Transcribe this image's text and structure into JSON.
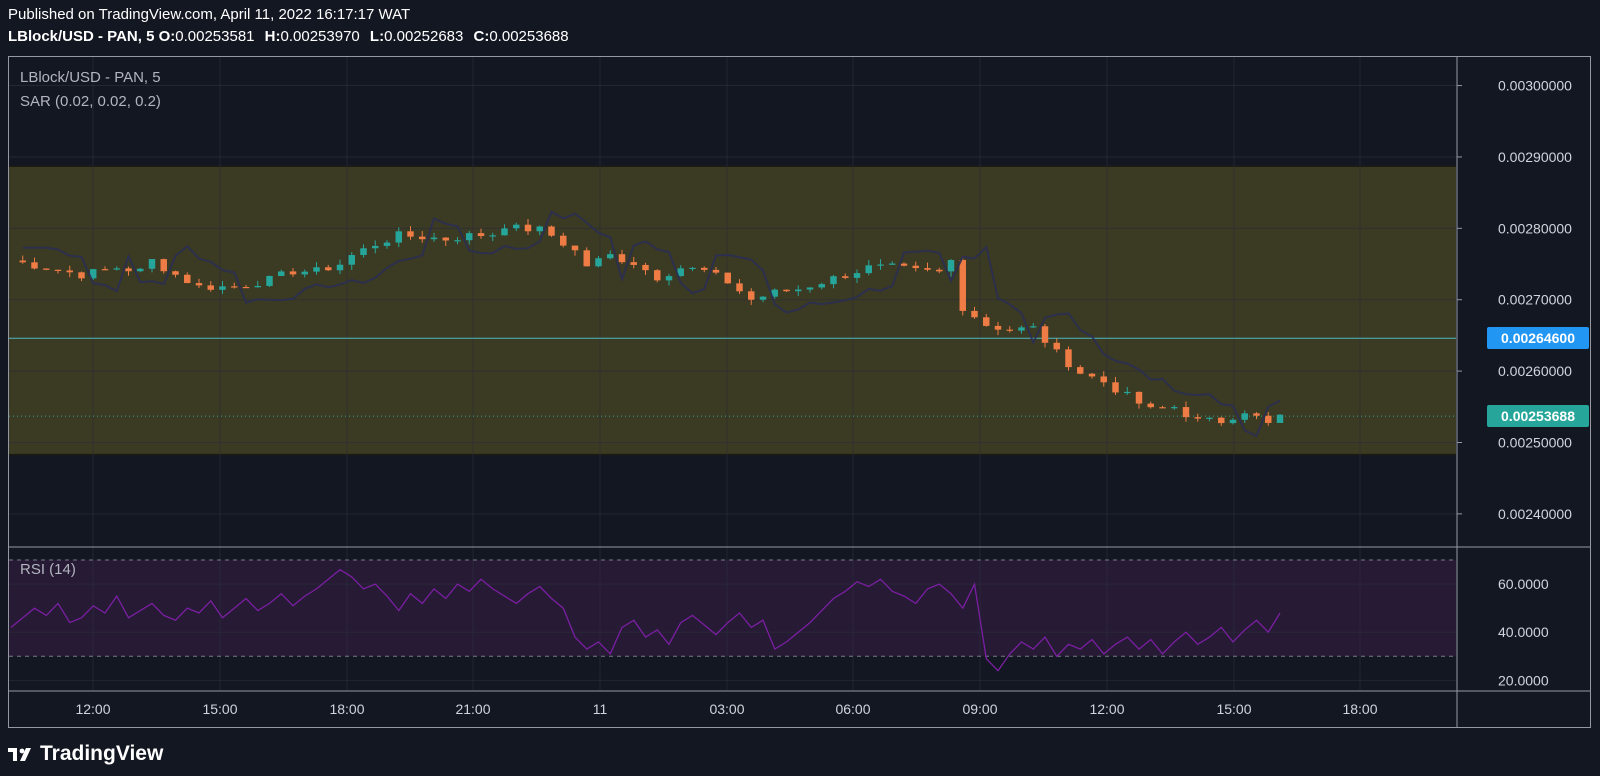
{
  "header": {
    "published": "Published on TradingView.com, April 11, 2022 16:17:17 WAT",
    "symbol": "LBlock/USD - PAN, 5",
    "ohlc": [
      {
        "label": "O:",
        "value": "0.00253581"
      },
      {
        "label": "H:",
        "value": "0.00253970"
      },
      {
        "label": "L:",
        "value": "0.00252683"
      },
      {
        "label": "C:",
        "value": "0.00253688"
      }
    ]
  },
  "legend": {
    "symbol": "LBlock/USD - PAN, 5",
    "indicator": "SAR (0.02, 0.02, 0.2)",
    "rsi": "RSI (14)"
  },
  "price_tags": {
    "level": "0.00264600",
    "last": "0.00253688"
  },
  "footer": {
    "brand": "TradingView"
  },
  "colors": {
    "background": "#131722",
    "up": "#26a69a",
    "down": "#ef7b45",
    "zone": "#3b3a22",
    "rsi": "#7b1fa2",
    "level_line": "#4fb8c4",
    "level_tag": "#2196f3",
    "last_tag": "#26a69a"
  },
  "chart_data": [
    {
      "type": "candlestick",
      "title": "LBlock/USD - PAN, 5",
      "x_ticks": [
        "12:00",
        "15:00",
        "18:00",
        "21:00",
        "11",
        "03:00",
        "06:00",
        "09:00",
        "12:00",
        "15:00",
        "18:00"
      ],
      "y_ticks": [
        "0.00300000",
        "0.00290000",
        "0.00280000",
        "0.00270000",
        "0.00260000",
        "0.00250000",
        "0.00240000"
      ],
      "ylim": [
        0.002355,
        0.00304
      ],
      "zone": [
        0.002483,
        0.002887
      ],
      "horizontal_level": 0.002646,
      "last_price": 0.00253688,
      "close_path": [
        [
          0,
          0.002755
        ],
        [
          3,
          0.002745
        ],
        [
          6,
          0.002735
        ],
        [
          9,
          0.002745
        ],
        [
          11,
          0.00274
        ],
        [
          12,
          0.002755
        ],
        [
          14,
          0.002735
        ],
        [
          16,
          0.002718
        ],
        [
          19,
          0.002718
        ],
        [
          22,
          0.002728
        ],
        [
          24,
          0.00274
        ],
        [
          26,
          0.00274
        ],
        [
          28,
          0.00275
        ],
        [
          29,
          0.002762
        ],
        [
          31,
          0.002778
        ],
        [
          33,
          0.00279
        ],
        [
          35,
          0.002788
        ],
        [
          37,
          0.002785
        ],
        [
          39,
          0.00279
        ],
        [
          41,
          0.002792
        ],
        [
          42,
          0.002805
        ],
        [
          43,
          0.0028
        ],
        [
          45,
          0.002798
        ],
        [
          46,
          0.00279
        ],
        [
          48,
          0.002768
        ],
        [
          49,
          0.002748
        ],
        [
          51,
          0.002762
        ],
        [
          53,
          0.002752
        ],
        [
          55,
          0.002732
        ],
        [
          57,
          0.002745
        ],
        [
          59,
          0.00274
        ],
        [
          61,
          0.002725
        ],
        [
          63,
          0.0027
        ],
        [
          65,
          0.00271
        ],
        [
          67,
          0.002715
        ],
        [
          69,
          0.002725
        ],
        [
          71,
          0.002735
        ],
        [
          73,
          0.002745
        ],
        [
          75,
          0.002745
        ],
        [
          77,
          0.00274
        ],
        [
          79,
          0.002738
        ],
        [
          80,
          0.002755
        ],
        [
          81,
          0.00269
        ],
        [
          83,
          0.002665
        ],
        [
          85,
          0.002658
        ],
        [
          87,
          0.00266
        ],
        [
          89,
          0.002625
        ],
        [
          91,
          0.002598
        ],
        [
          93,
          0.002585
        ],
        [
          95,
          0.002565
        ],
        [
          97,
          0.002545
        ],
        [
          99,
          0.00255
        ],
        [
          101,
          0.00253
        ],
        [
          103,
          0.00253
        ],
        [
          105,
          0.002545
        ],
        [
          107,
          0.002525
        ],
        [
          108,
          0.002537
        ]
      ],
      "sar_lag": 3
    },
    {
      "type": "line",
      "title": "RSI (14)",
      "y_ticks": [
        "60.0000",
        "40.0000",
        "20.0000"
      ],
      "ylim": [
        16,
        75
      ],
      "upper_band": 70,
      "lower_band": 30,
      "values": [
        42,
        46,
        50,
        47,
        52,
        44,
        46,
        51,
        48,
        55,
        46,
        49,
        52,
        47,
        45,
        50,
        48,
        53,
        46,
        50,
        54,
        49,
        52,
        56,
        51,
        55,
        58,
        62,
        66,
        63,
        58,
        60,
        55,
        49,
        56,
        52,
        58,
        54,
        60,
        57,
        62,
        58,
        55,
        52,
        56,
        59,
        54,
        50,
        38,
        33,
        36,
        31,
        42,
        45,
        38,
        41,
        35,
        44,
        47,
        43,
        39,
        44,
        48,
        42,
        45,
        33,
        36,
        40,
        44,
        49,
        54,
        57,
        61,
        59,
        62,
        57,
        55,
        52,
        58,
        60,
        56,
        50,
        60,
        29,
        24,
        31,
        36,
        33,
        38,
        30,
        35,
        33,
        37,
        31,
        35,
        38,
        33,
        37,
        31,
        36,
        40,
        35,
        38,
        42,
        36,
        41,
        45,
        40,
        48
      ]
    }
  ]
}
